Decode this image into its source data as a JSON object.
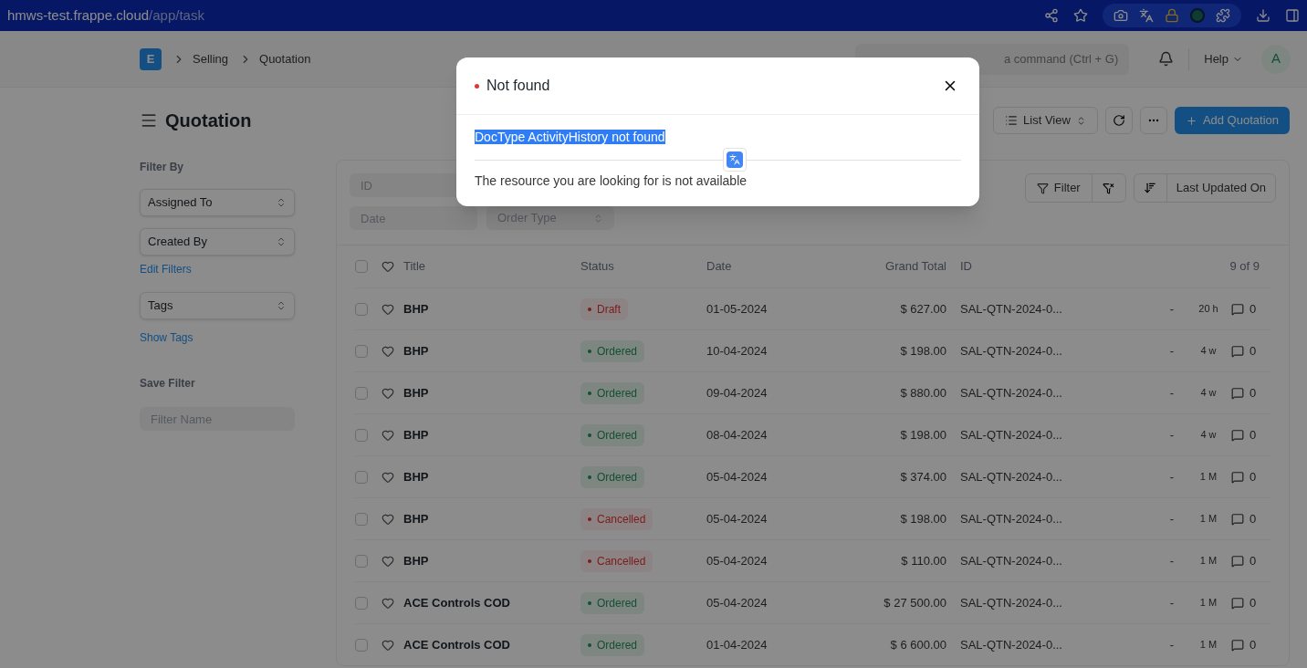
{
  "browser": {
    "url_host": "hmws-test.frappe.cloud",
    "url_path": "/app/task"
  },
  "navbar": {
    "logo": "E",
    "breadcrumbs": [
      "Selling",
      "Quotation"
    ],
    "search_placeholder": "a command (Ctrl + G)",
    "help": "Help",
    "avatar": "A"
  },
  "page": {
    "title": "Quotation",
    "view_button": "List View",
    "add_button": "Add Quotation"
  },
  "sidebar": {
    "heading": "Filter By",
    "selects": [
      "Assigned To",
      "Created By"
    ],
    "edit_filters": "Edit Filters",
    "tags_select": "Tags",
    "show_tags": "Show Tags",
    "save_heading": "Save Filter",
    "filter_name_placeholder": "Filter Name"
  },
  "filters": {
    "id_placeholder": "ID",
    "date_placeholder": "Date",
    "order_type_placeholder": "Order Type",
    "filter_button": "Filter",
    "sort_label": "Last Updated On"
  },
  "table": {
    "columns": [
      "Title",
      "Status",
      "Date",
      "Grand Total",
      "ID"
    ],
    "count": "9 of 9",
    "all_checked": false,
    "rows": [
      {
        "checked": false,
        "title": "BHP",
        "status": "Draft",
        "kind": "draft",
        "date": "01-05-2024",
        "total": "$ 627.00",
        "id": "SAL-QTN-2024-0...",
        "dash": "-",
        "time": "20 h",
        "comments": "0"
      },
      {
        "checked": false,
        "title": "BHP",
        "status": "Ordered",
        "kind": "ordered",
        "date": "10-04-2024",
        "total": "$ 198.00",
        "id": "SAL-QTN-2024-0...",
        "dash": "-",
        "time": "4 w",
        "comments": "0"
      },
      {
        "checked": false,
        "title": "BHP",
        "status": "Ordered",
        "kind": "ordered",
        "date": "09-04-2024",
        "total": "$ 880.00",
        "id": "SAL-QTN-2024-0...",
        "dash": "-",
        "time": "4 w",
        "comments": "0"
      },
      {
        "checked": false,
        "title": "BHP",
        "status": "Ordered",
        "kind": "ordered",
        "date": "08-04-2024",
        "total": "$ 198.00",
        "id": "SAL-QTN-2024-0...",
        "dash": "-",
        "time": "4 w",
        "comments": "0"
      },
      {
        "checked": false,
        "title": "BHP",
        "status": "Ordered",
        "kind": "ordered",
        "date": "05-04-2024",
        "total": "$ 374.00",
        "id": "SAL-QTN-2024-0...",
        "dash": "-",
        "time": "1 M",
        "comments": "0"
      },
      {
        "checked": false,
        "title": "BHP",
        "status": "Cancelled",
        "kind": "cancelled",
        "date": "05-04-2024",
        "total": "$ 198.00",
        "id": "SAL-QTN-2024-0...",
        "dash": "-",
        "time": "1 M",
        "comments": "0"
      },
      {
        "checked": false,
        "title": "BHP",
        "status": "Cancelled",
        "kind": "cancelled",
        "date": "05-04-2024",
        "total": "$ 110.00",
        "id": "SAL-QTN-2024-0...",
        "dash": "-",
        "time": "1 M",
        "comments": "0"
      },
      {
        "checked": false,
        "title": "ACE Controls COD",
        "status": "Ordered",
        "kind": "ordered",
        "date": "05-04-2024",
        "total": "$ 27 500.00",
        "id": "SAL-QTN-2024-0...",
        "dash": "-",
        "time": "1 M",
        "comments": "0"
      },
      {
        "checked": false,
        "title": "ACE Controls COD",
        "status": "Ordered",
        "kind": "ordered",
        "date": "01-04-2024",
        "total": "$ 6 600.00",
        "id": "SAL-QTN-2024-0...",
        "dash": "-",
        "time": "1 M",
        "comments": "0"
      }
    ]
  },
  "dialog": {
    "title": "Not found",
    "selected_text": "DocType ActivityHistory not found",
    "message": "The resource you are looking for is not available"
  }
}
